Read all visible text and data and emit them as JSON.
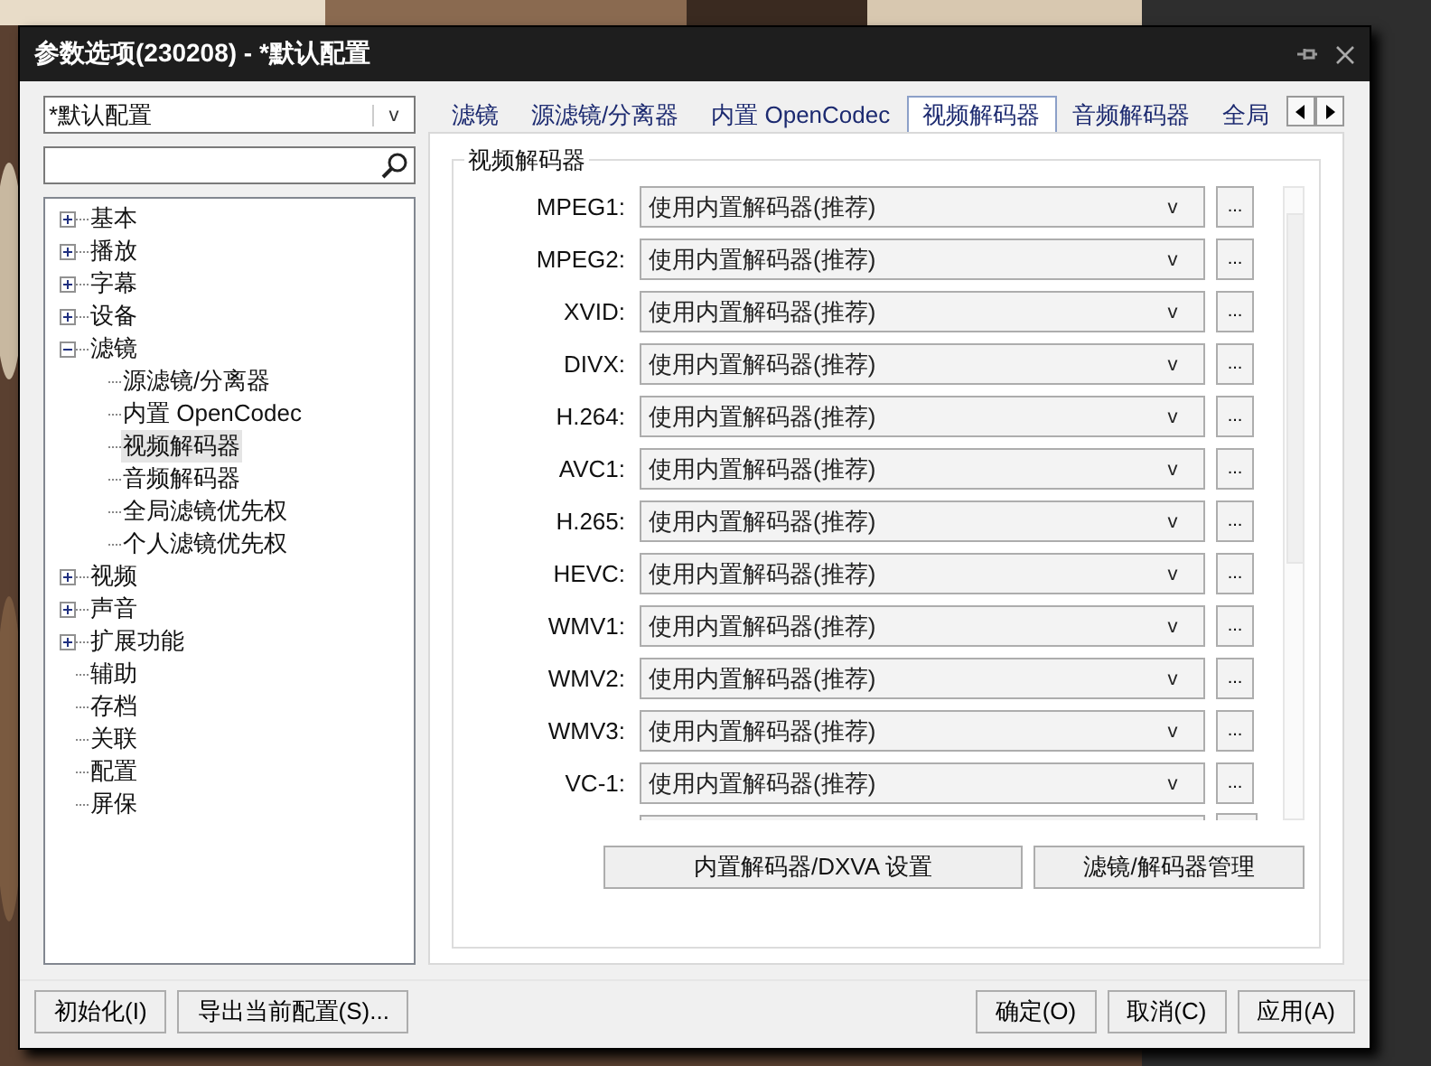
{
  "window": {
    "title": "参数选项(230208) - *默认配置"
  },
  "profile": {
    "value": "*默认配置",
    "arrow": "v"
  },
  "tree": [
    {
      "label": "基本",
      "expanded": false,
      "selected": false
    },
    {
      "label": "播放",
      "expanded": false,
      "selected": false
    },
    {
      "label": "字幕",
      "expanded": false,
      "selected": false
    },
    {
      "label": "设备",
      "expanded": false,
      "selected": false
    },
    {
      "label": "滤镜",
      "expanded": true,
      "selected": false,
      "children": [
        {
          "label": "源滤镜/分离器",
          "selected": false
        },
        {
          "label": "内置 OpenCodec",
          "selected": false
        },
        {
          "label": "视频解码器",
          "selected": true
        },
        {
          "label": "音频解码器",
          "selected": false
        },
        {
          "label": "全局滤镜优先权",
          "selected": false
        },
        {
          "label": "个人滤镜优先权",
          "selected": false
        }
      ]
    },
    {
      "label": "视频",
      "expanded": false,
      "selected": false
    },
    {
      "label": "声音",
      "expanded": false,
      "selected": false
    },
    {
      "label": "扩展功能",
      "expanded": false,
      "selected": false
    },
    {
      "label": "辅助",
      "selected": false
    },
    {
      "label": "存档",
      "selected": false
    },
    {
      "label": "关联",
      "selected": false
    },
    {
      "label": "配置",
      "selected": false
    },
    {
      "label": "屏保",
      "selected": false
    }
  ],
  "tabs": [
    {
      "label": "滤镜",
      "selected": false
    },
    {
      "label": "源滤镜/分离器",
      "selected": false
    },
    {
      "label": "内置 OpenCodec",
      "selected": false
    },
    {
      "label": "视频解码器",
      "selected": true
    },
    {
      "label": "音频解码器",
      "selected": false
    },
    {
      "label": "全局",
      "selected": false
    }
  ],
  "group": {
    "title": "视频解码器",
    "codecs": [
      {
        "label": "MPEG1:",
        "value": "使用内置解码器(推荐)",
        "arrow": "v",
        "more": "..."
      },
      {
        "label": "MPEG2:",
        "value": "使用内置解码器(推荐)",
        "arrow": "v",
        "more": "..."
      },
      {
        "label": "XVID:",
        "value": "使用内置解码器(推荐)",
        "arrow": "v",
        "more": "..."
      },
      {
        "label": "DIVX:",
        "value": "使用内置解码器(推荐)",
        "arrow": "v",
        "more": "..."
      },
      {
        "label": "H.264:",
        "value": "使用内置解码器(推荐)",
        "arrow": "v",
        "more": "..."
      },
      {
        "label": "AVC1:",
        "value": "使用内置解码器(推荐)",
        "arrow": "v",
        "more": "..."
      },
      {
        "label": "H.265:",
        "value": "使用内置解码器(推荐)",
        "arrow": "v",
        "more": "..."
      },
      {
        "label": "HEVC:",
        "value": "使用内置解码器(推荐)",
        "arrow": "v",
        "more": "..."
      },
      {
        "label": "WMV1:",
        "value": "使用内置解码器(推荐)",
        "arrow": "v",
        "more": "..."
      },
      {
        "label": "WMV2:",
        "value": "使用内置解码器(推荐)",
        "arrow": "v",
        "more": "..."
      },
      {
        "label": "WMV3:",
        "value": "使用内置解码器(推荐)",
        "arrow": "v",
        "more": "..."
      },
      {
        "label": "VC-1:",
        "value": "使用内置解码器(推荐)",
        "arrow": "v",
        "more": "..."
      }
    ],
    "buttons": [
      "内置解码器/DXVA 设置",
      "滤镜/解码器管理"
    ]
  },
  "footer_left": [
    "初始化(I)",
    "导出当前配置(S)..."
  ],
  "footer_right": [
    "确定(O)",
    "取消(C)",
    "应用(A)"
  ]
}
